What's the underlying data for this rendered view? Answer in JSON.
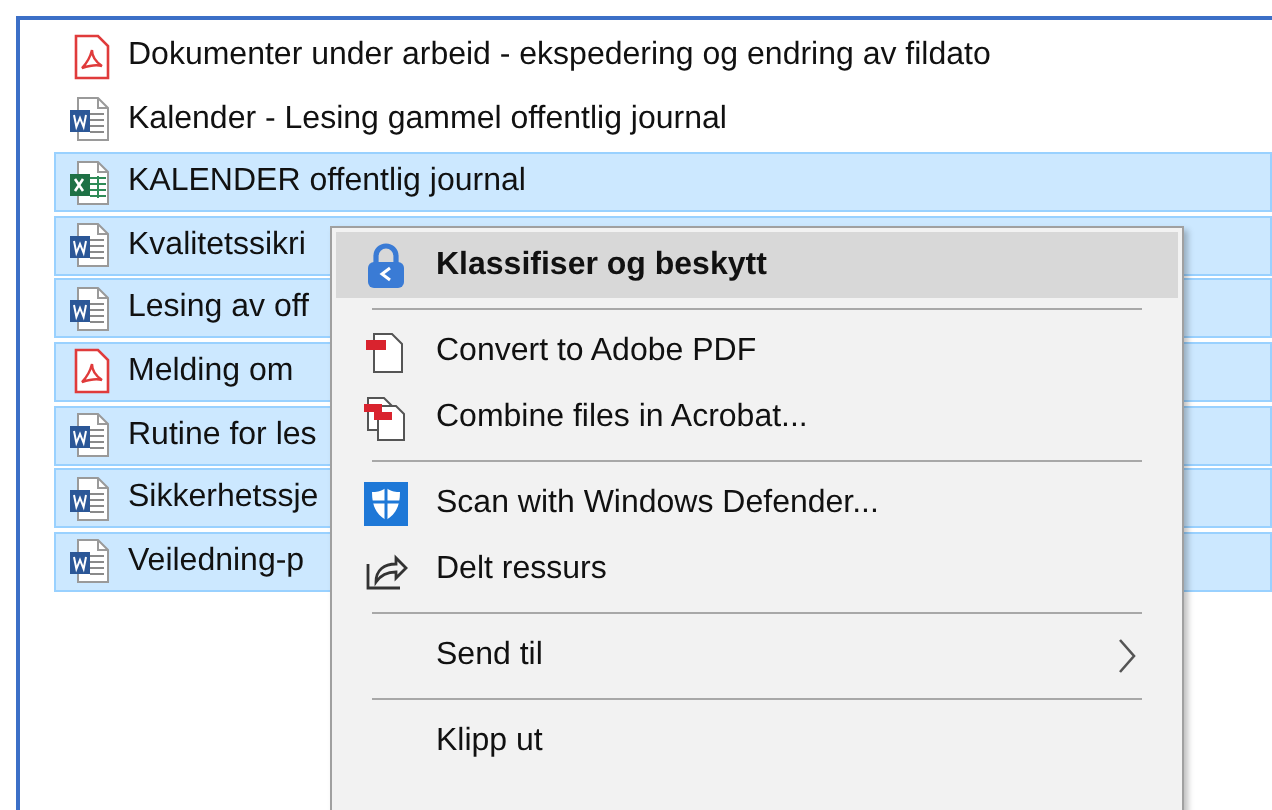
{
  "files": [
    {
      "name": "Dokumenter under arbeid - ekspedering og endring av fildato",
      "kind": "pdf",
      "selected": false
    },
    {
      "name": "Kalender - Lesing gammel offentlig journal",
      "kind": "word",
      "selected": false
    },
    {
      "name": "KALENDER offentlig journal",
      "kind": "excel",
      "selected": true
    },
    {
      "name": "Kvalitetssikri",
      "kind": "word",
      "selected": true
    },
    {
      "name": "Lesing av off",
      "kind": "word",
      "selected": true
    },
    {
      "name": "Melding om",
      "kind": "pdf",
      "selected": true
    },
    {
      "name": "Rutine for les",
      "kind": "word",
      "selected": true
    },
    {
      "name": "Sikkerhetssje",
      "kind": "word",
      "selected": true
    },
    {
      "name": "Veiledning-p",
      "kind": "word",
      "selected": true
    }
  ],
  "context_menu": {
    "items": [
      {
        "kind": "lock",
        "label": "Klassifiser og beskytt",
        "bold": true,
        "selected": true
      },
      {
        "kind": "separator"
      },
      {
        "kind": "convert",
        "label": "Convert to Adobe PDF",
        "bold": false,
        "selected": false
      },
      {
        "kind": "combine",
        "label": "Combine files in Acrobat...",
        "bold": false,
        "selected": false
      },
      {
        "kind": "separator"
      },
      {
        "kind": "shield",
        "label": "Scan with Windows Defender...",
        "bold": false,
        "selected": false
      },
      {
        "kind": "share",
        "label": "Delt ressurs",
        "bold": false,
        "selected": false
      },
      {
        "kind": "separator"
      },
      {
        "kind": "submenu",
        "label": "Send til",
        "bold": false,
        "selected": false
      },
      {
        "kind": "separator"
      },
      {
        "kind": "plain",
        "label": "Klipp ut",
        "bold": false,
        "selected": false
      }
    ]
  }
}
